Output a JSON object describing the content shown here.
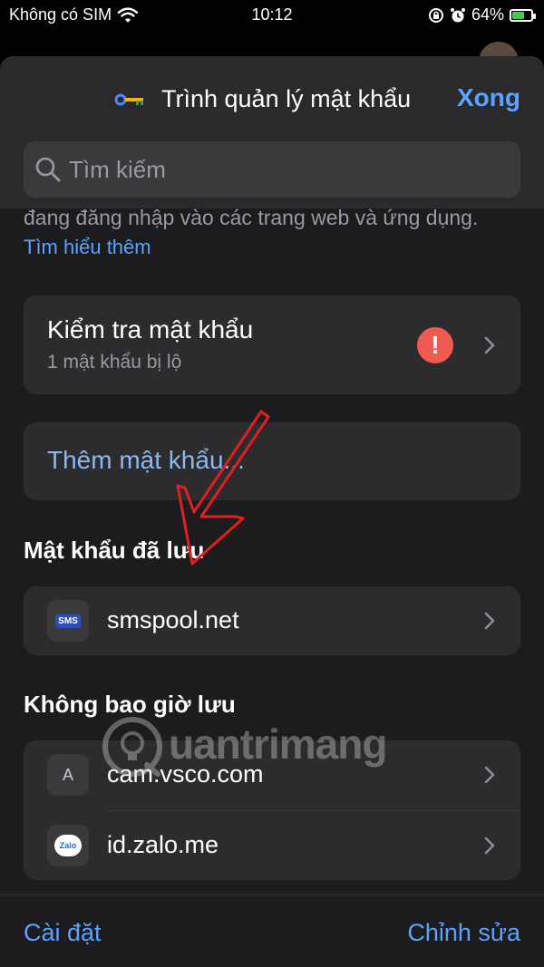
{
  "status_bar": {
    "carrier": "Không có SIM",
    "time": "10:12",
    "battery": "64%",
    "battery_level": 0.64,
    "icons": [
      "wifi-icon",
      "orientation-lock-icon",
      "alarm-icon",
      "battery-charging-icon"
    ]
  },
  "header": {
    "title": "Trình quản lý mật khẩu",
    "done_label": "Xong",
    "search_placeholder": "Tìm kiếm"
  },
  "intro": {
    "partial_text": "đang đăng nhập vào các trang web và ứng dụng.",
    "learn_more": "Tìm hiểu thêm"
  },
  "password_check": {
    "title": "Kiểm tra mật khẩu",
    "subtitle": "1 mật khẩu bị lộ",
    "badge": "!"
  },
  "add_password": {
    "label": "Thêm mật khẩu..."
  },
  "saved_section": {
    "heading": "Mật khẩu đã lưu",
    "items": [
      {
        "site": "smspool.net",
        "icon_text": "SMS"
      }
    ]
  },
  "never_saved_section": {
    "heading": "Không bao giờ lưu",
    "items": [
      {
        "site": "cam.vsco.com",
        "icon_text": "A"
      },
      {
        "site": "id.zalo.me",
        "icon_text": "Zalo"
      }
    ]
  },
  "watermark": "uantrimang",
  "bottom_bar": {
    "settings_label": "Cài đặt",
    "edit_label": "Chỉnh sửa"
  },
  "colors": {
    "accent": "#5aa4ff",
    "warning": "#ef5b50",
    "annotation_arrow": "#e02020"
  }
}
